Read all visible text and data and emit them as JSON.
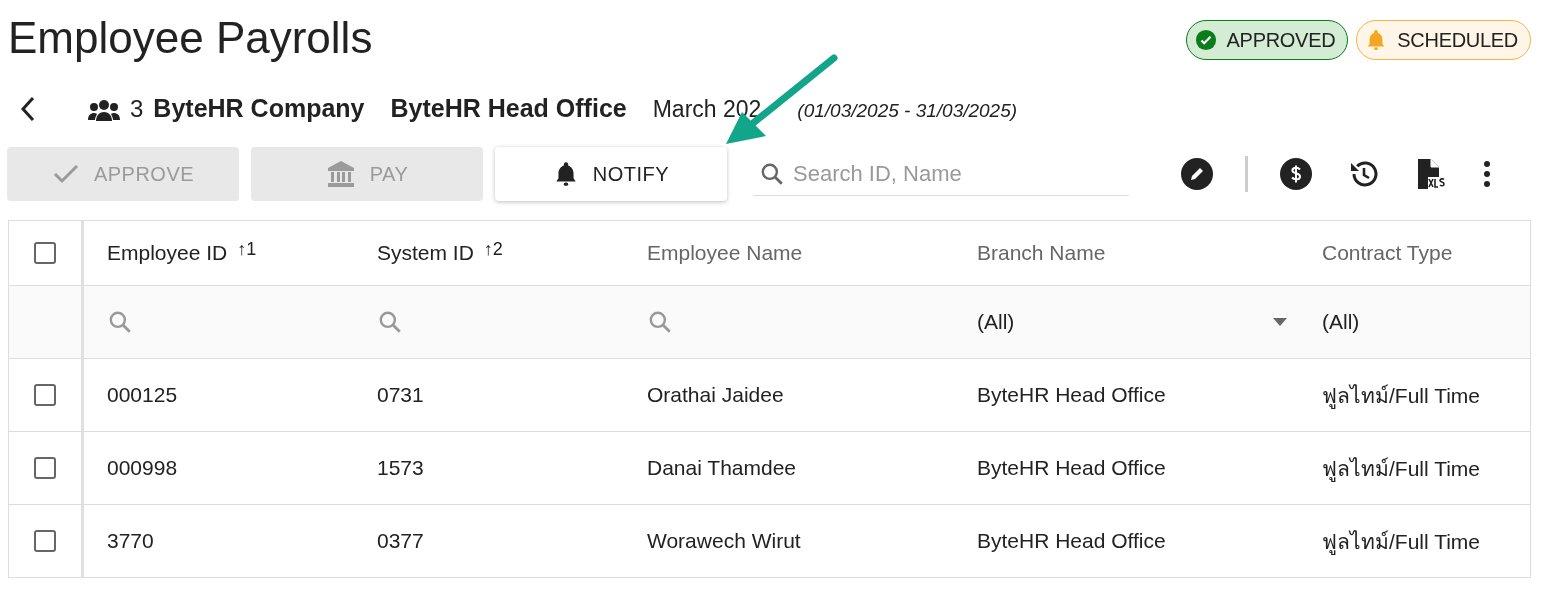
{
  "page": {
    "title": "Employee Payrolls"
  },
  "badges": [
    {
      "kind": "approved",
      "label": "APPROVED"
    },
    {
      "kind": "scheduled",
      "label": "SCHEDULED"
    }
  ],
  "summary": {
    "employee_count": "3",
    "company": "ByteHR Company",
    "branch": "ByteHR Head Office",
    "period": "March 202",
    "date_range": "(01/03/2025 - 31/03/2025)"
  },
  "actions": [
    {
      "kind": "approve",
      "label": "APPROVE",
      "disabled": true
    },
    {
      "kind": "pay",
      "label": "PAY",
      "disabled": true
    },
    {
      "kind": "notify",
      "label": "NOTIFY",
      "disabled": false
    }
  ],
  "search": {
    "placeholder": "Search ID, Name"
  },
  "toolbar_icons": [
    {
      "kind": "edit"
    },
    {
      "kind": "divider"
    },
    {
      "kind": "money"
    },
    {
      "kind": "history"
    },
    {
      "kind": "xls"
    },
    {
      "kind": "more"
    }
  ],
  "table": {
    "select_all": {
      "checked": false
    },
    "columns": [
      {
        "label": "Employee ID",
        "sorted": true,
        "sort_arrow": "↑",
        "sort_order": "1",
        "filter": {
          "kind": "search"
        }
      },
      {
        "label": "System ID",
        "sorted": true,
        "sort_arrow": "↑",
        "sort_order": "2",
        "filter": {
          "kind": "search"
        }
      },
      {
        "label": "Employee Name",
        "sorted": false,
        "filter": {
          "kind": "search"
        }
      },
      {
        "label": "Branch Name",
        "sorted": false,
        "filter": {
          "kind": "dropdown",
          "value": "(All)"
        }
      },
      {
        "label": "Contract Type",
        "sorted": false,
        "filter": {
          "kind": "value",
          "value": "(All)"
        }
      }
    ],
    "rows": [
      {
        "checked": false,
        "cells": [
          "000125",
          "0731",
          "Orathai Jaidee",
          "ByteHR Head Office",
          "ฟูลไทม์/Full Time"
        ]
      },
      {
        "checked": false,
        "cells": [
          "000998",
          "1573",
          "Danai Thamdee",
          "ByteHR Head Office",
          "ฟูลไทม์/Full Time"
        ]
      },
      {
        "checked": false,
        "cells": [
          "3770",
          "0377",
          "Worawech Wirut",
          "ByteHR Head Office",
          "ฟูลไทม์/Full Time"
        ]
      }
    ]
  }
}
